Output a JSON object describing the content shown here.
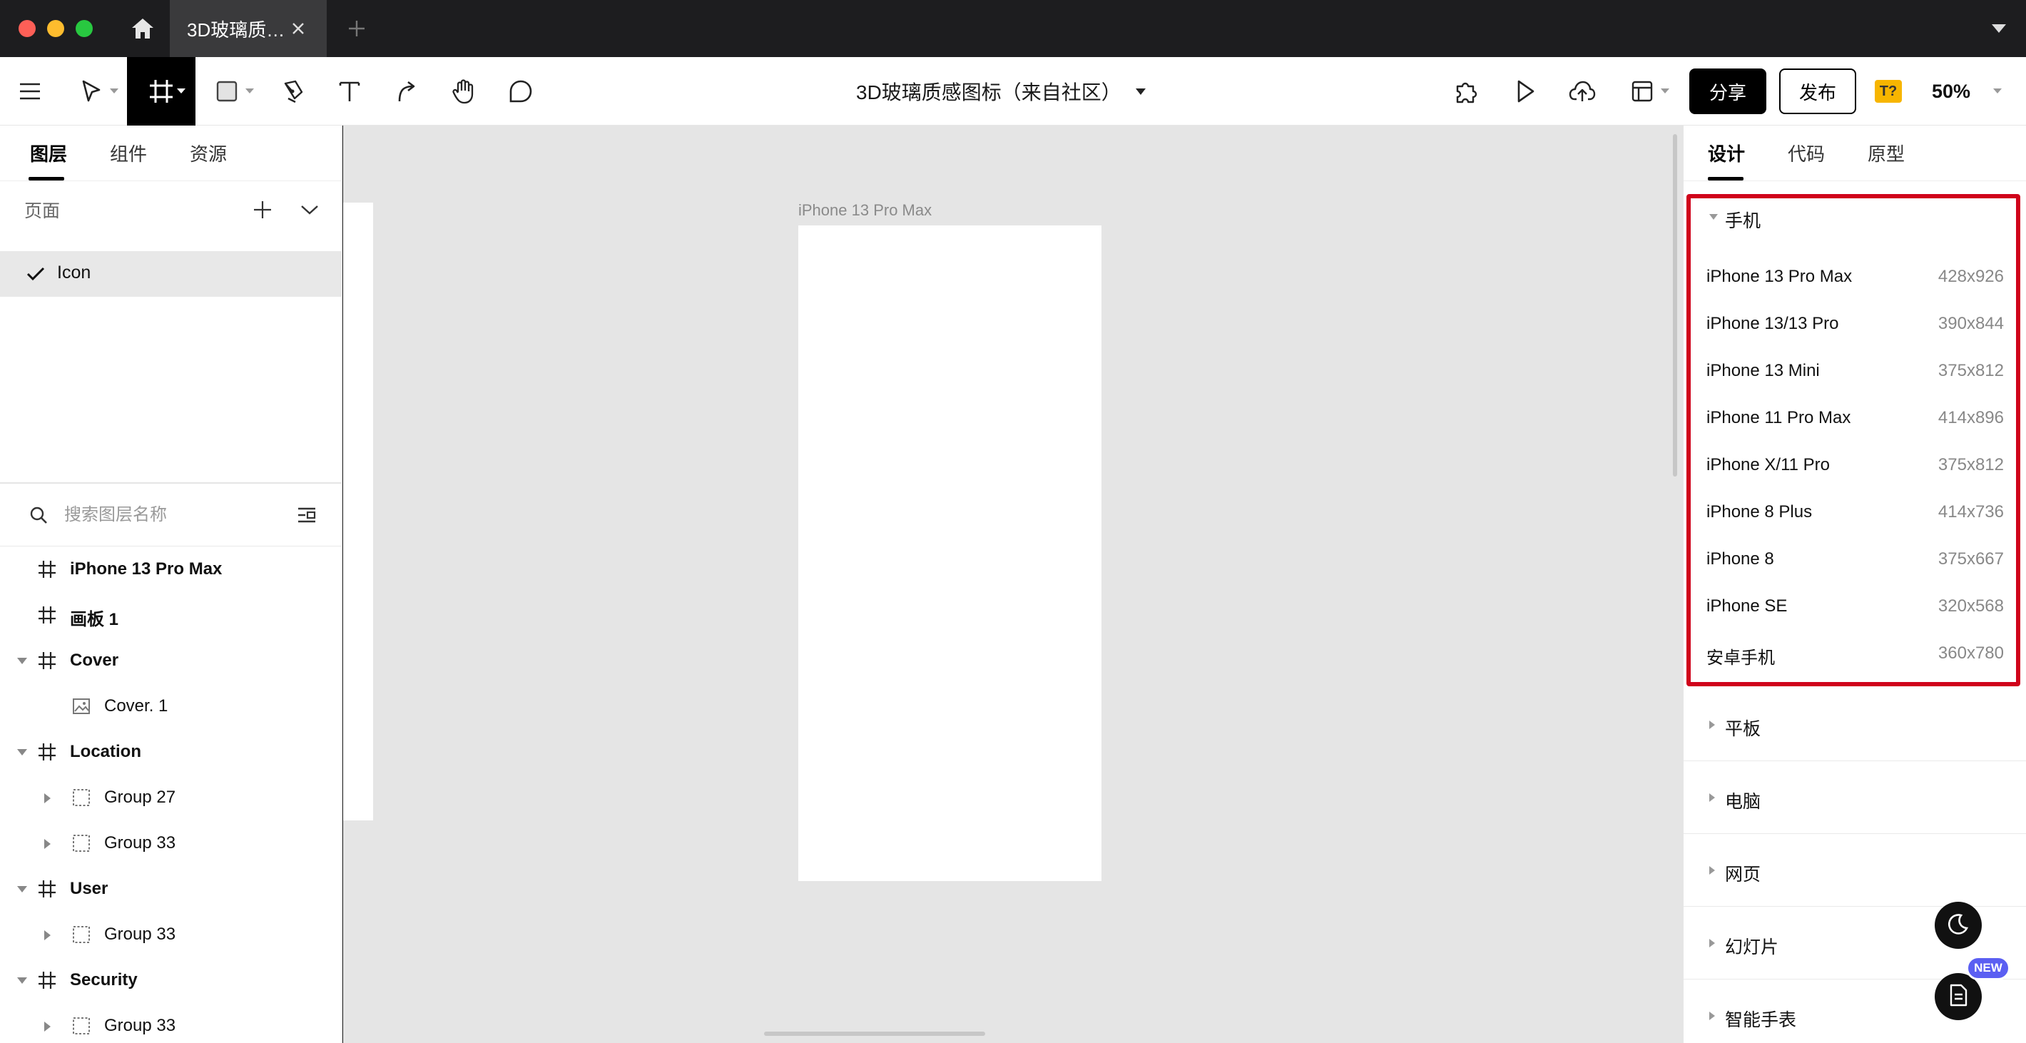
{
  "tabbar": {
    "doc_tab_title": "3D玻璃质…"
  },
  "toolbar": {
    "doc_title": "3D玻璃质感图标（来自社区）",
    "share_label": "分享",
    "publish_label": "发布",
    "font_badge": "T?",
    "zoom": "50%"
  },
  "left_panel": {
    "tabs": [
      "图层",
      "组件",
      "资源"
    ],
    "pages_label": "页面",
    "current_page": "Icon",
    "search_placeholder": "搜索图层名称",
    "layers": [
      {
        "label": "iPhone 13 Pro Max",
        "type": "frame",
        "indent": 0,
        "arrow": "none"
      },
      {
        "label": "画板 1",
        "type": "frame",
        "indent": 0,
        "arrow": "none"
      },
      {
        "label": "Cover",
        "type": "frame",
        "indent": 0,
        "arrow": "down"
      },
      {
        "label": "Cover. 1",
        "type": "image",
        "indent": 1,
        "arrow": "none"
      },
      {
        "label": "Location",
        "type": "frame",
        "indent": 0,
        "arrow": "down"
      },
      {
        "label": "Group 27",
        "type": "group",
        "indent": 1,
        "arrow": "right"
      },
      {
        "label": "Group 33",
        "type": "group",
        "indent": 1,
        "arrow": "right"
      },
      {
        "label": "User",
        "type": "frame",
        "indent": 0,
        "arrow": "down"
      },
      {
        "label": "Group 33",
        "type": "group",
        "indent": 1,
        "arrow": "right"
      },
      {
        "label": "Security",
        "type": "frame",
        "indent": 0,
        "arrow": "down"
      },
      {
        "label": "Group 33",
        "type": "group",
        "indent": 1,
        "arrow": "right"
      }
    ]
  },
  "canvas": {
    "frame_label": "iPhone 13 Pro Max"
  },
  "right_panel": {
    "tabs": [
      "设计",
      "代码",
      "原型"
    ],
    "expanded_category": "手机",
    "devices": [
      {
        "name": "iPhone 13 Pro Max",
        "size": "428x926"
      },
      {
        "name": "iPhone 13/13 Pro",
        "size": "390x844"
      },
      {
        "name": "iPhone 13 Mini",
        "size": "375x812"
      },
      {
        "name": "iPhone 11 Pro Max",
        "size": "414x896"
      },
      {
        "name": "iPhone X/11 Pro",
        "size": "375x812"
      },
      {
        "name": "iPhone 8 Plus",
        "size": "414x736"
      },
      {
        "name": "iPhone 8",
        "size": "375x667"
      },
      {
        "name": "iPhone SE",
        "size": "320x568"
      },
      {
        "name": "安卓手机",
        "size": "360x780"
      }
    ],
    "collapsed_categories": [
      "平板",
      "电脑",
      "网页",
      "幻灯片",
      "智能手表"
    ],
    "new_badge": "NEW",
    "highlight_color": "#d0021b"
  }
}
